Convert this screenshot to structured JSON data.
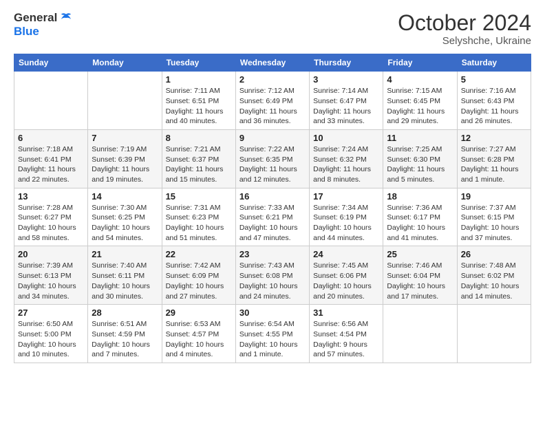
{
  "header": {
    "logo_general": "General",
    "logo_blue": "Blue",
    "month": "October 2024",
    "location": "Selyshche, Ukraine"
  },
  "weekdays": [
    "Sunday",
    "Monday",
    "Tuesday",
    "Wednesday",
    "Thursday",
    "Friday",
    "Saturday"
  ],
  "weeks": [
    [
      {
        "day": "",
        "sunrise": "",
        "sunset": "",
        "daylight": ""
      },
      {
        "day": "",
        "sunrise": "",
        "sunset": "",
        "daylight": ""
      },
      {
        "day": "1",
        "sunrise": "Sunrise: 7:11 AM",
        "sunset": "Sunset: 6:51 PM",
        "daylight": "Daylight: 11 hours and 40 minutes."
      },
      {
        "day": "2",
        "sunrise": "Sunrise: 7:12 AM",
        "sunset": "Sunset: 6:49 PM",
        "daylight": "Daylight: 11 hours and 36 minutes."
      },
      {
        "day": "3",
        "sunrise": "Sunrise: 7:14 AM",
        "sunset": "Sunset: 6:47 PM",
        "daylight": "Daylight: 11 hours and 33 minutes."
      },
      {
        "day": "4",
        "sunrise": "Sunrise: 7:15 AM",
        "sunset": "Sunset: 6:45 PM",
        "daylight": "Daylight: 11 hours and 29 minutes."
      },
      {
        "day": "5",
        "sunrise": "Sunrise: 7:16 AM",
        "sunset": "Sunset: 6:43 PM",
        "daylight": "Daylight: 11 hours and 26 minutes."
      }
    ],
    [
      {
        "day": "6",
        "sunrise": "Sunrise: 7:18 AM",
        "sunset": "Sunset: 6:41 PM",
        "daylight": "Daylight: 11 hours and 22 minutes."
      },
      {
        "day": "7",
        "sunrise": "Sunrise: 7:19 AM",
        "sunset": "Sunset: 6:39 PM",
        "daylight": "Daylight: 11 hours and 19 minutes."
      },
      {
        "day": "8",
        "sunrise": "Sunrise: 7:21 AM",
        "sunset": "Sunset: 6:37 PM",
        "daylight": "Daylight: 11 hours and 15 minutes."
      },
      {
        "day": "9",
        "sunrise": "Sunrise: 7:22 AM",
        "sunset": "Sunset: 6:35 PM",
        "daylight": "Daylight: 11 hours and 12 minutes."
      },
      {
        "day": "10",
        "sunrise": "Sunrise: 7:24 AM",
        "sunset": "Sunset: 6:32 PM",
        "daylight": "Daylight: 11 hours and 8 minutes."
      },
      {
        "day": "11",
        "sunrise": "Sunrise: 7:25 AM",
        "sunset": "Sunset: 6:30 PM",
        "daylight": "Daylight: 11 hours and 5 minutes."
      },
      {
        "day": "12",
        "sunrise": "Sunrise: 7:27 AM",
        "sunset": "Sunset: 6:28 PM",
        "daylight": "Daylight: 11 hours and 1 minute."
      }
    ],
    [
      {
        "day": "13",
        "sunrise": "Sunrise: 7:28 AM",
        "sunset": "Sunset: 6:27 PM",
        "daylight": "Daylight: 10 hours and 58 minutes."
      },
      {
        "day": "14",
        "sunrise": "Sunrise: 7:30 AM",
        "sunset": "Sunset: 6:25 PM",
        "daylight": "Daylight: 10 hours and 54 minutes."
      },
      {
        "day": "15",
        "sunrise": "Sunrise: 7:31 AM",
        "sunset": "Sunset: 6:23 PM",
        "daylight": "Daylight: 10 hours and 51 minutes."
      },
      {
        "day": "16",
        "sunrise": "Sunrise: 7:33 AM",
        "sunset": "Sunset: 6:21 PM",
        "daylight": "Daylight: 10 hours and 47 minutes."
      },
      {
        "day": "17",
        "sunrise": "Sunrise: 7:34 AM",
        "sunset": "Sunset: 6:19 PM",
        "daylight": "Daylight: 10 hours and 44 minutes."
      },
      {
        "day": "18",
        "sunrise": "Sunrise: 7:36 AM",
        "sunset": "Sunset: 6:17 PM",
        "daylight": "Daylight: 10 hours and 41 minutes."
      },
      {
        "day": "19",
        "sunrise": "Sunrise: 7:37 AM",
        "sunset": "Sunset: 6:15 PM",
        "daylight": "Daylight: 10 hours and 37 minutes."
      }
    ],
    [
      {
        "day": "20",
        "sunrise": "Sunrise: 7:39 AM",
        "sunset": "Sunset: 6:13 PM",
        "daylight": "Daylight: 10 hours and 34 minutes."
      },
      {
        "day": "21",
        "sunrise": "Sunrise: 7:40 AM",
        "sunset": "Sunset: 6:11 PM",
        "daylight": "Daylight: 10 hours and 30 minutes."
      },
      {
        "day": "22",
        "sunrise": "Sunrise: 7:42 AM",
        "sunset": "Sunset: 6:09 PM",
        "daylight": "Daylight: 10 hours and 27 minutes."
      },
      {
        "day": "23",
        "sunrise": "Sunrise: 7:43 AM",
        "sunset": "Sunset: 6:08 PM",
        "daylight": "Daylight: 10 hours and 24 minutes."
      },
      {
        "day": "24",
        "sunrise": "Sunrise: 7:45 AM",
        "sunset": "Sunset: 6:06 PM",
        "daylight": "Daylight: 10 hours and 20 minutes."
      },
      {
        "day": "25",
        "sunrise": "Sunrise: 7:46 AM",
        "sunset": "Sunset: 6:04 PM",
        "daylight": "Daylight: 10 hours and 17 minutes."
      },
      {
        "day": "26",
        "sunrise": "Sunrise: 7:48 AM",
        "sunset": "Sunset: 6:02 PM",
        "daylight": "Daylight: 10 hours and 14 minutes."
      }
    ],
    [
      {
        "day": "27",
        "sunrise": "Sunrise: 6:50 AM",
        "sunset": "Sunset: 5:00 PM",
        "daylight": "Daylight: 10 hours and 10 minutes."
      },
      {
        "day": "28",
        "sunrise": "Sunrise: 6:51 AM",
        "sunset": "Sunset: 4:59 PM",
        "daylight": "Daylight: 10 hours and 7 minutes."
      },
      {
        "day": "29",
        "sunrise": "Sunrise: 6:53 AM",
        "sunset": "Sunset: 4:57 PM",
        "daylight": "Daylight: 10 hours and 4 minutes."
      },
      {
        "day": "30",
        "sunrise": "Sunrise: 6:54 AM",
        "sunset": "Sunset: 4:55 PM",
        "daylight": "Daylight: 10 hours and 1 minute."
      },
      {
        "day": "31",
        "sunrise": "Sunrise: 6:56 AM",
        "sunset": "Sunset: 4:54 PM",
        "daylight": "Daylight: 9 hours and 57 minutes."
      },
      {
        "day": "",
        "sunrise": "",
        "sunset": "",
        "daylight": ""
      },
      {
        "day": "",
        "sunrise": "",
        "sunset": "",
        "daylight": ""
      }
    ]
  ]
}
